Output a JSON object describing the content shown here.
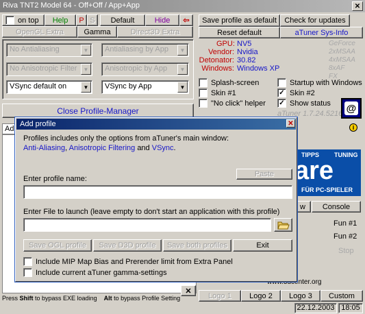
{
  "window": {
    "title": "Riva TNT2 Model 64 - Off+Off / App+App"
  },
  "toolbar": {
    "on_top": "on top",
    "help": "Help",
    "p": "P",
    "s": "S",
    "default": "Default",
    "hide": "Hide",
    "opengl_extra": "OpenGL Extra",
    "gamma": "Gamma",
    "direct3d_extra": "Direct3D Extra"
  },
  "right_buttons": {
    "save_profile_default": "Save profile as default",
    "check_updates": "Check for updates",
    "reset_default": "Reset default",
    "sysinfo": "aTuner Sys-Info"
  },
  "sysinfo": {
    "gpu_label": "GPU:",
    "gpu_value": "NV5",
    "vendor_label": "Vendor:",
    "vendor_value": "Nvidia",
    "detonator_label": "Detonator:",
    "detonator_value": "30.82",
    "windows_label": "Windows:",
    "windows_value": "Windows XP",
    "side": [
      "GeForce",
      "2xMSAA",
      "4xMSAA",
      "8xAF",
      "FX"
    ]
  },
  "combos": {
    "aa": "No Antialiasing",
    "af": "No Anisotropic Filter",
    "vsync": "VSync default on",
    "aa_app": "Antialiasing by App",
    "af_app": "Anisotropic by App",
    "vsync_app": "VSync by App"
  },
  "options": {
    "splash": "Splash-screen",
    "skin1": "Skin #1",
    "noclick": "\"No click\" helper",
    "startup": "Startup with Windows",
    "skin2": "Skin #2",
    "status": "Show status",
    "version": "aTuner 1.7.24.5216"
  },
  "close_profile_manager": "Close Profile-Manager",
  "add_tab": "Add",
  "ad": {
    "tipps": "TIPPS",
    "tuning": "TUNING",
    "big": "are",
    "sub": "FÜR PC-SPIELER",
    "url": "www.3dcenter.org"
  },
  "panel_tabs": {
    "view": "w",
    "console": "Console"
  },
  "fun": {
    "fun1": "Fun #1",
    "fun2": "Fun #2",
    "stop": "Stop"
  },
  "logos": {
    "logo1": "Logo 1",
    "logo2": "Logo 2",
    "logo3": "Logo 3",
    "custom": "Custom"
  },
  "footer": {
    "press": "Press ",
    "shift": "Shift",
    "bypass_exe": " to bypass EXE loading",
    "alt": "Alt",
    "bypass_profile": " to bypass Profile Setting"
  },
  "status_bar": {
    "date": "22.12.2003",
    "time": "18:05"
  },
  "dialog": {
    "title": "Add profile",
    "info_line1": "Profiles includes only the options from aTuner's main window:",
    "aa": "Anti-Aliasing",
    "comma": ",",
    "af": "Anisotropic Filtering",
    "and": "and",
    "vsync": "VSync",
    "period": ".",
    "paste": "Paste",
    "profile_name_label": "Enter profile name:",
    "profile_name_value": "",
    "file_label": "Enter File to launch (leave empty to don't start an application with this profile)",
    "file_value": "",
    "save_ogl": "Save OGL profile",
    "save_d3d": "Save D3D profile",
    "save_both": "Save both profiles",
    "exit": "Exit",
    "mip_map": "Include MIP Map Bias and Prerender limit from Extra Panel",
    "gamma": "Include current aTuner gamma-settings"
  }
}
